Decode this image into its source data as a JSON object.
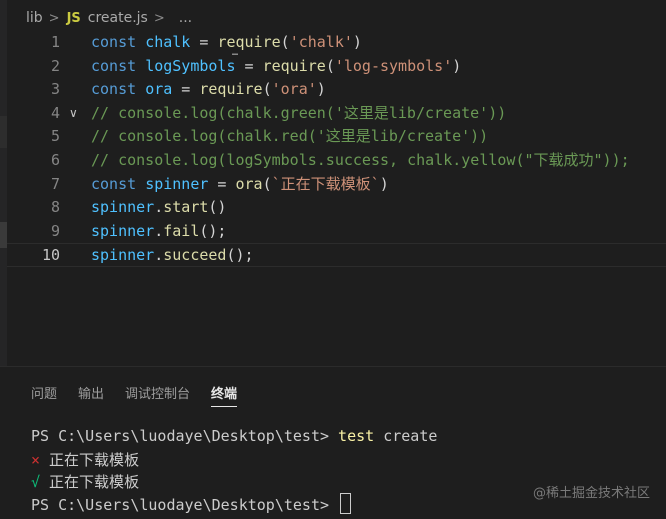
{
  "breadcrumb": {
    "folder": "lib",
    "separator": ">",
    "file_icon": "JS",
    "file": "create.js",
    "ellipsis": "..."
  },
  "editor": {
    "lines": [
      {
        "num": "1",
        "tokens": [
          [
            "kw",
            "const"
          ],
          [
            "plain",
            " "
          ],
          [
            "var",
            "chalk"
          ],
          [
            "plain",
            " = "
          ],
          [
            "fn",
            "require"
          ],
          [
            "plain",
            "("
          ],
          [
            "str",
            "'chalk'"
          ],
          [
            "plain",
            ")"
          ]
        ]
      },
      {
        "num": "2",
        "tokens": [
          [
            "kw",
            "const"
          ],
          [
            "plain",
            " "
          ],
          [
            "var",
            "logSymbols"
          ],
          [
            "plain",
            " = "
          ],
          [
            "fn",
            "require"
          ],
          [
            "plain",
            "("
          ],
          [
            "str",
            "'log-symbols'"
          ],
          [
            "plain",
            ")"
          ]
        ]
      },
      {
        "num": "3",
        "tokens": [
          [
            "kw",
            "const"
          ],
          [
            "plain",
            " "
          ],
          [
            "var",
            "ora"
          ],
          [
            "plain",
            " = "
          ],
          [
            "fn",
            "require"
          ],
          [
            "plain",
            "("
          ],
          [
            "str",
            "'ora'"
          ],
          [
            "plain",
            ")"
          ]
        ]
      },
      {
        "num": "4",
        "fold": true,
        "tokens": [
          [
            "cmt",
            "// console.log(chalk.green('这里是lib/create'))"
          ]
        ]
      },
      {
        "num": "5",
        "tokens": [
          [
            "cmt",
            "// console.log(chalk.red('这里是lib/create'))"
          ]
        ]
      },
      {
        "num": "6",
        "tokens": [
          [
            "cmt",
            "// console.log(logSymbols.success, chalk.yellow(\"下载成功\"));"
          ]
        ]
      },
      {
        "num": "7",
        "tokens": [
          [
            "kw",
            "const"
          ],
          [
            "plain",
            " "
          ],
          [
            "var",
            "spinner"
          ],
          [
            "plain",
            " = "
          ],
          [
            "fn",
            "ora"
          ],
          [
            "plain",
            "("
          ],
          [
            "str",
            "`正在下载模板`"
          ],
          [
            "plain",
            ")"
          ]
        ]
      },
      {
        "num": "8",
        "tokens": [
          [
            "var",
            "spinner"
          ],
          [
            "plain",
            "."
          ],
          [
            "fn",
            "start"
          ],
          [
            "plain",
            "()"
          ]
        ]
      },
      {
        "num": "9",
        "tokens": [
          [
            "var",
            "spinner"
          ],
          [
            "plain",
            "."
          ],
          [
            "fn",
            "fail"
          ],
          [
            "plain",
            "();"
          ]
        ]
      },
      {
        "num": "10",
        "current": true,
        "tokens": [
          [
            "var",
            "spinner"
          ],
          [
            "plain",
            "."
          ],
          [
            "fn",
            "succeed"
          ],
          [
            "plain",
            "();"
          ]
        ]
      }
    ]
  },
  "panel": {
    "tabs": [
      "问题",
      "输出",
      "调试控制台",
      "终端"
    ],
    "active_tab": "终端",
    "terminal": {
      "prompt1": "PS C:\\Users\\luodaye\\Desktop\\test> ",
      "command": "test",
      "command_arg": " create",
      "fail_symbol": "×",
      "fail_text": " 正在下载模板",
      "success_symbol": "√",
      "success_text": " 正在下载模板",
      "prompt2": "PS C:\\Users\\luodaye\\Desktop\\test> "
    }
  },
  "watermark": "@稀土掘金技术社区"
}
